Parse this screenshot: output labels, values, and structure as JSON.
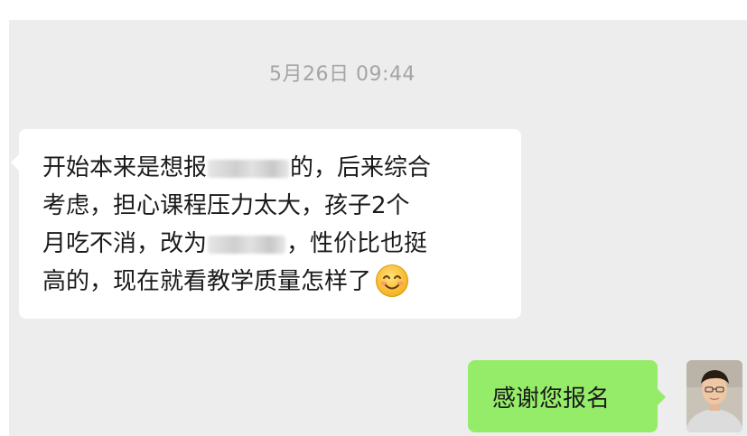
{
  "chat": {
    "timestamp": "5月26日 09:44",
    "incoming_message": {
      "lines": [
        {
          "before": "开始本来是想报",
          "after": "的，后来综合"
        },
        {
          "text": "考虑，担心课程压力太大，孩子2个"
        },
        {
          "before": "月吃不消，改为",
          "after": "，性价比也挺"
        },
        {
          "text": "高的，现在就看教学质量怎样了"
        }
      ],
      "emoji": "smiling-face-icon"
    },
    "outgoing_message": {
      "text": "感谢您报名"
    },
    "avatar": "user-avatar"
  },
  "colors": {
    "chat_background": "#ededed",
    "incoming_bubble": "#ffffff",
    "outgoing_bubble": "#95ec69",
    "timestamp_text": "#a5a5a5"
  }
}
